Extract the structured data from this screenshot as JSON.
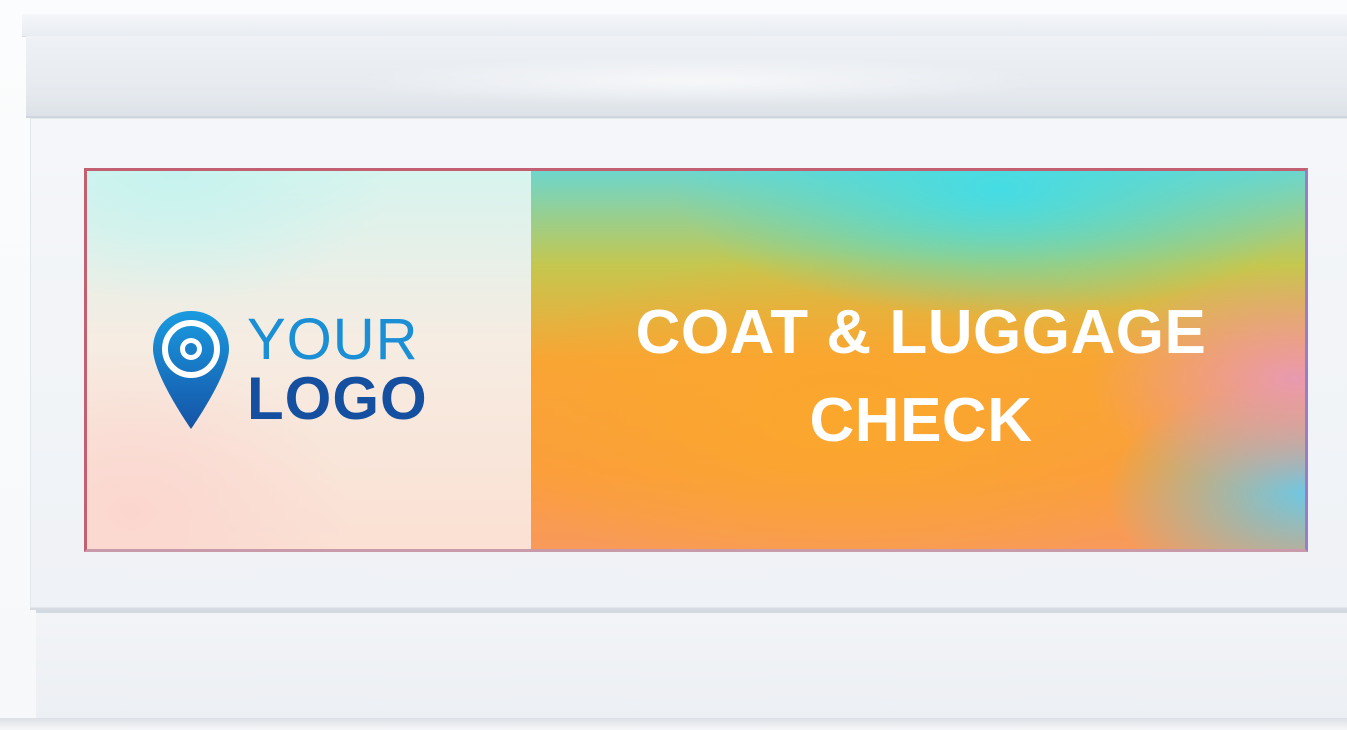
{
  "sign": {
    "logo": {
      "line1": "YOUR",
      "line2": "LOGO",
      "icon": "location-pin-icon"
    },
    "headline": {
      "line1": "COAT & LUGGAGE",
      "line2": "CHECK"
    }
  },
  "colors": {
    "logo_light_blue": "#1b8fd6",
    "logo_dark_blue": "#154fa0",
    "headline_text": "#ffffff",
    "gradient_orange": "#fba72c",
    "gradient_cyan": "#45dce4"
  }
}
